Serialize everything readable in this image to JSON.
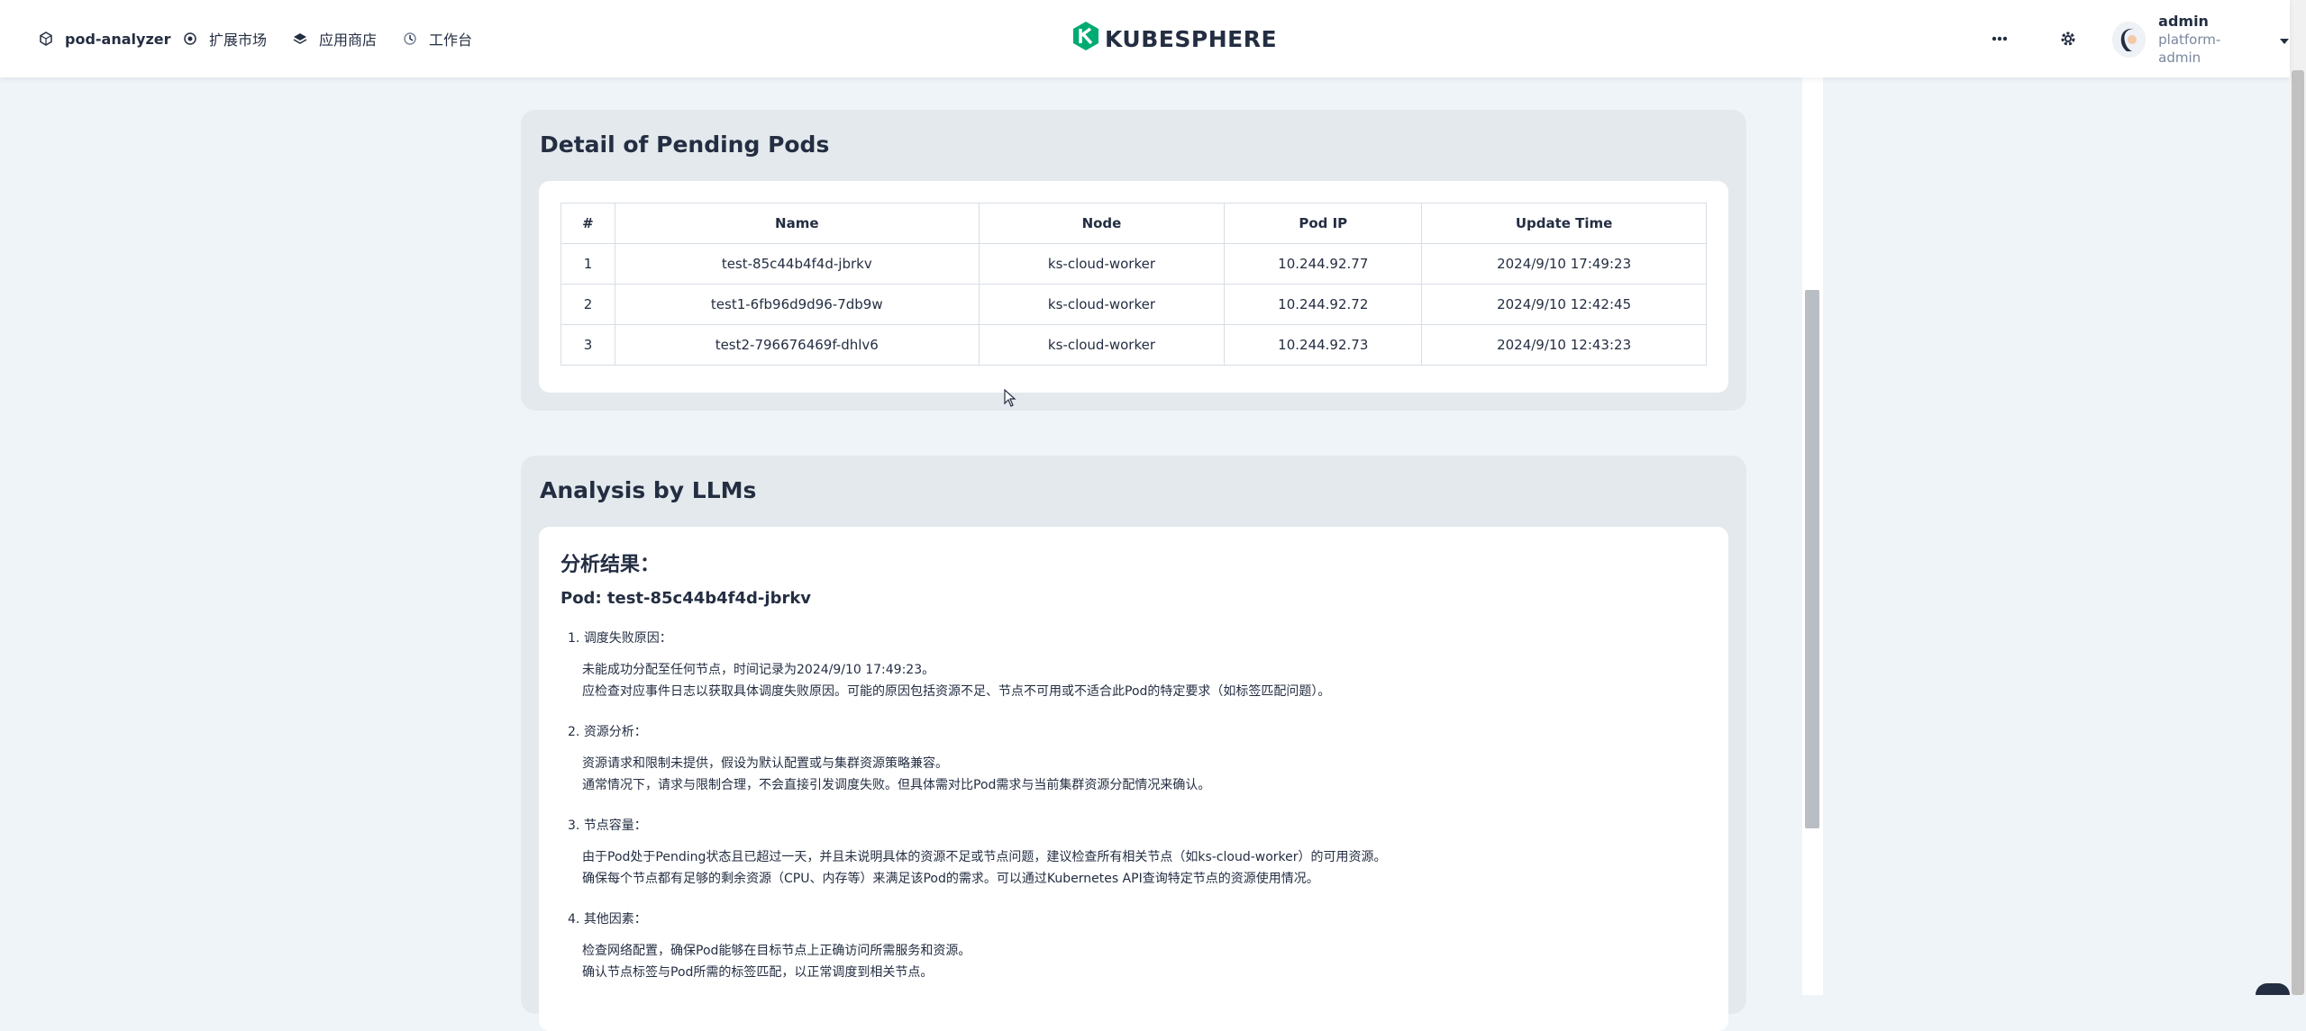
{
  "nav": {
    "items": [
      {
        "label": "pod-analyzer",
        "icon": "cube-icon"
      },
      {
        "label": "扩展市场",
        "icon": "extension-icon"
      },
      {
        "label": "应用商店",
        "icon": "app-store-icon"
      },
      {
        "label": "工作台",
        "icon": "workbench-icon"
      }
    ],
    "logo_text": "KUBESPHERE",
    "user": {
      "name": "admin",
      "role": "platform-admin"
    }
  },
  "pending": {
    "title": "Detail of Pending Pods",
    "columns": [
      "#",
      "Name",
      "Node",
      "Pod IP",
      "Update Time"
    ],
    "rows": [
      [
        "1",
        "test-85c44b4f4d-jbrkv",
        "ks-cloud-worker",
        "10.244.92.77",
        "2024/9/10 17:49:23"
      ],
      [
        "2",
        "test1-6fb96d9d96-7db9w",
        "ks-cloud-worker",
        "10.244.92.72",
        "2024/9/10 12:42:45"
      ],
      [
        "3",
        "test2-796676469f-dhlv6",
        "ks-cloud-worker",
        "10.244.92.73",
        "2024/9/10 12:43:23"
      ]
    ]
  },
  "analysis": {
    "title": "Analysis by LLMs",
    "heading": "分析结果：",
    "pod_heading": "Pod: test-85c44b4f4d-jbrkv",
    "items": [
      {
        "label": "调度失败原因：",
        "lines": [
          "未能成功分配至任何节点，时间记录为2024/9/10 17:49:23。",
          "应检查对应事件日志以获取具体调度失败原因。可能的原因包括资源不足、节点不可用或不适合此Pod的特定要求（如标签匹配问题）。"
        ]
      },
      {
        "label": "资源分析：",
        "lines": [
          "资源请求和限制未提供，假设为默认配置或与集群资源策略兼容。",
          "通常情况下，请求与限制合理，不会直接引发调度失败。但具体需对比Pod需求与当前集群资源分配情况来确认。"
        ]
      },
      {
        "label": "节点容量：",
        "lines": [
          "由于Pod处于Pending状态且已超过一天，并且未说明具体的资源不足或节点问题，建议检查所有相关节点（如ks-cloud-worker）的可用资源。",
          "确保每个节点都有足够的剩余资源（CPU、内存等）来满足该Pod的需求。可以通过Kubernetes API查询特定节点的资源使用情况。"
        ]
      },
      {
        "label": "其他因素：",
        "lines": [
          "检查网络配置，确保Pod能够在目标节点上正确访问所需服务和资源。",
          "确认节点标签与Pod所需的标签匹配，以正常调度到相关节点。"
        ]
      }
    ]
  }
}
